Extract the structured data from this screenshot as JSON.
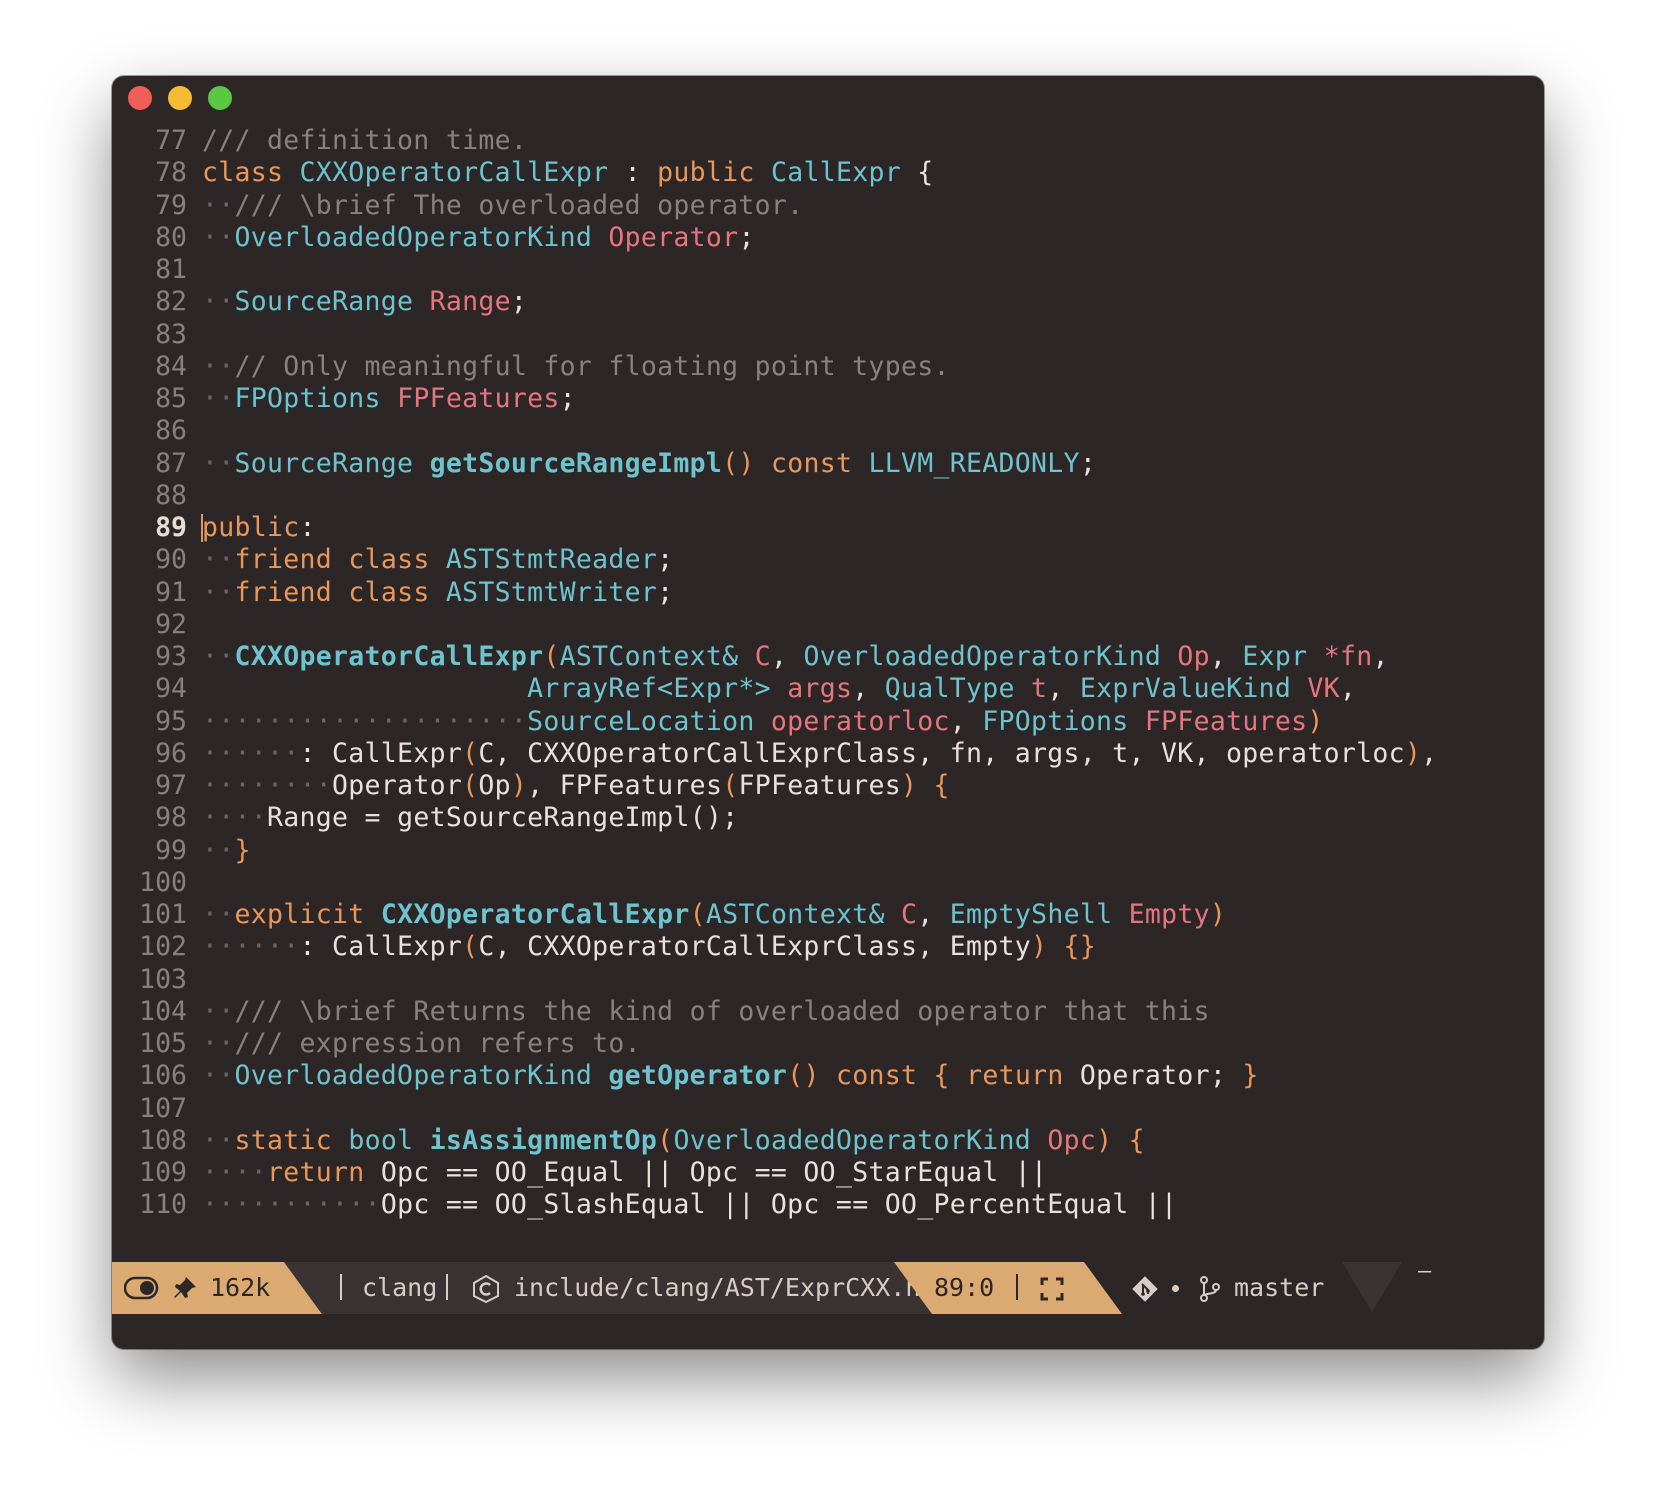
{
  "window": {
    "traffic_lights": [
      "close",
      "minimize",
      "maximize"
    ]
  },
  "editor": {
    "current_line": 89,
    "lines": [
      {
        "n": "77",
        "t": [
          [
            "cm",
            "/// definition time."
          ]
        ]
      },
      {
        "n": "78",
        "t": [
          [
            "kw",
            "class"
          ],
          [
            "pu",
            " "
          ],
          [
            "ty",
            "CXXOperatorCallExpr"
          ],
          [
            "pu",
            " : "
          ],
          [
            "kw",
            "public"
          ],
          [
            "pu",
            " "
          ],
          [
            "ty",
            "CallExpr"
          ],
          [
            "pu",
            " {"
          ]
        ]
      },
      {
        "n": "79",
        "t": [
          [
            "ws",
            "··"
          ],
          [
            "cm",
            "/// \\brief The overloaded operator."
          ]
        ]
      },
      {
        "n": "80",
        "t": [
          [
            "ws",
            "··"
          ],
          [
            "ty",
            "OverloadedOperatorKind"
          ],
          [
            "pu",
            " "
          ],
          [
            "va",
            "Operator"
          ],
          [
            "pu",
            ";"
          ]
        ]
      },
      {
        "n": "81",
        "t": []
      },
      {
        "n": "82",
        "t": [
          [
            "ws",
            "··"
          ],
          [
            "ty",
            "SourceRange"
          ],
          [
            "pu",
            " "
          ],
          [
            "va",
            "Range"
          ],
          [
            "pu",
            ";"
          ]
        ]
      },
      {
        "n": "83",
        "t": []
      },
      {
        "n": "84",
        "t": [
          [
            "ws",
            "··"
          ],
          [
            "cm",
            "// Only meaningful for floating point types."
          ]
        ]
      },
      {
        "n": "85",
        "t": [
          [
            "ws",
            "··"
          ],
          [
            "ty",
            "FPOptions"
          ],
          [
            "pu",
            " "
          ],
          [
            "va",
            "FPFeatures"
          ],
          [
            "pu",
            ";"
          ]
        ]
      },
      {
        "n": "86",
        "t": []
      },
      {
        "n": "87",
        "t": [
          [
            "ws",
            "··"
          ],
          [
            "ty",
            "SourceRange"
          ],
          [
            "pu",
            " "
          ],
          [
            "fn",
            "getSourceRangeImpl"
          ],
          [
            "pa",
            "()"
          ],
          [
            "pu",
            " "
          ],
          [
            "kw",
            "const"
          ],
          [
            "pu",
            " "
          ],
          [
            "ty",
            "LLVM_READONLY"
          ],
          [
            "pu",
            ";"
          ]
        ]
      },
      {
        "n": "88",
        "t": []
      },
      {
        "n": "89",
        "t": [
          [
            "kw",
            "public"
          ],
          [
            "pu",
            ":"
          ]
        ]
      },
      {
        "n": "90",
        "t": [
          [
            "ws",
            "··"
          ],
          [
            "kw",
            "friend"
          ],
          [
            "pu",
            " "
          ],
          [
            "kw",
            "class"
          ],
          [
            "pu",
            " "
          ],
          [
            "ty",
            "ASTStmtReader"
          ],
          [
            "pu",
            ";"
          ]
        ]
      },
      {
        "n": "91",
        "t": [
          [
            "ws",
            "··"
          ],
          [
            "kw",
            "friend"
          ],
          [
            "pu",
            " "
          ],
          [
            "kw",
            "class"
          ],
          [
            "pu",
            " "
          ],
          [
            "ty",
            "ASTStmtWriter"
          ],
          [
            "pu",
            ";"
          ]
        ]
      },
      {
        "n": "92",
        "t": []
      },
      {
        "n": "93",
        "t": [
          [
            "ws",
            "··"
          ],
          [
            "fn",
            "CXXOperatorCallExpr"
          ],
          [
            "pa",
            "("
          ],
          [
            "ty",
            "ASTContext&"
          ],
          [
            "pu",
            " "
          ],
          [
            "va",
            "C"
          ],
          [
            "pu",
            ", "
          ],
          [
            "ty",
            "OverloadedOperatorKind"
          ],
          [
            "pu",
            " "
          ],
          [
            "va",
            "Op"
          ],
          [
            "pu",
            ", "
          ],
          [
            "ty",
            "Expr"
          ],
          [
            "pu",
            " "
          ],
          [
            "va",
            "*fn"
          ],
          [
            "pu",
            ","
          ]
        ]
      },
      {
        "n": "94",
        "t": [
          [
            "pu",
            "                    "
          ],
          [
            "ty",
            "ArrayRef<Expr*>"
          ],
          [
            "pu",
            " "
          ],
          [
            "va",
            "args"
          ],
          [
            "pu",
            ", "
          ],
          [
            "ty",
            "QualType"
          ],
          [
            "pu",
            " "
          ],
          [
            "va",
            "t"
          ],
          [
            "pu",
            ", "
          ],
          [
            "ty",
            "ExprValueKind"
          ],
          [
            "pu",
            " "
          ],
          [
            "va",
            "VK"
          ],
          [
            "pu",
            ","
          ]
        ]
      },
      {
        "n": "95",
        "t": [
          [
            "ws",
            "····················"
          ],
          [
            "ty",
            "SourceLocation"
          ],
          [
            "pu",
            " "
          ],
          [
            "va",
            "operatorloc"
          ],
          [
            "pu",
            ", "
          ],
          [
            "ty",
            "FPOptions"
          ],
          [
            "pu",
            " "
          ],
          [
            "va",
            "FPFeatures"
          ],
          [
            "pa",
            ")"
          ]
        ]
      },
      {
        "n": "96",
        "t": [
          [
            "ws",
            "······"
          ],
          [
            "pu",
            ": CallExpr"
          ],
          [
            "pa",
            "("
          ],
          [
            "pu",
            "C, CXXOperatorCallExprClass, fn, args, t, VK, operatorloc"
          ],
          [
            "pa",
            ")"
          ],
          [
            "pu",
            ","
          ]
        ]
      },
      {
        "n": "97",
        "t": [
          [
            "ws",
            "········"
          ],
          [
            "pu",
            "Operator"
          ],
          [
            "pa",
            "("
          ],
          [
            "pu",
            "Op"
          ],
          [
            "pa",
            ")"
          ],
          [
            "pu",
            ", FPFeatures"
          ],
          [
            "pa",
            "("
          ],
          [
            "pu",
            "FPFeatures"
          ],
          [
            "pa",
            ")"
          ],
          [
            "pu",
            " "
          ],
          [
            "pa",
            "{"
          ]
        ]
      },
      {
        "n": "98",
        "t": [
          [
            "ws",
            "····"
          ],
          [
            "pu",
            "Range = getSourceRangeImpl();"
          ]
        ]
      },
      {
        "n": "99",
        "t": [
          [
            "ws",
            "··"
          ],
          [
            "pa",
            "}"
          ]
        ]
      },
      {
        "n": "100",
        "t": []
      },
      {
        "n": "101",
        "t": [
          [
            "ws",
            "··"
          ],
          [
            "kw",
            "explicit"
          ],
          [
            "pu",
            " "
          ],
          [
            "fn",
            "CXXOperatorCallExpr"
          ],
          [
            "pa",
            "("
          ],
          [
            "ty",
            "ASTContext&"
          ],
          [
            "pu",
            " "
          ],
          [
            "va",
            "C"
          ],
          [
            "pu",
            ", "
          ],
          [
            "ty",
            "EmptyShell"
          ],
          [
            "pu",
            " "
          ],
          [
            "va",
            "Empty"
          ],
          [
            "pa",
            ")"
          ]
        ]
      },
      {
        "n": "102",
        "t": [
          [
            "ws",
            "······"
          ],
          [
            "pu",
            ": CallExpr"
          ],
          [
            "pa",
            "("
          ],
          [
            "pu",
            "C, CXXOperatorCallExprClass, Empty"
          ],
          [
            "pa",
            ")"
          ],
          [
            "pu",
            " "
          ],
          [
            "pa",
            "{}"
          ]
        ]
      },
      {
        "n": "103",
        "t": []
      },
      {
        "n": "104",
        "t": [
          [
            "ws",
            "··"
          ],
          [
            "cm",
            "/// \\brief Returns the kind of overloaded operator that this"
          ]
        ]
      },
      {
        "n": "105",
        "t": [
          [
            "ws",
            "··"
          ],
          [
            "cm",
            "/// expression refers to."
          ]
        ]
      },
      {
        "n": "106",
        "t": [
          [
            "ws",
            "··"
          ],
          [
            "ty",
            "OverloadedOperatorKind"
          ],
          [
            "pu",
            " "
          ],
          [
            "fn",
            "getOperator"
          ],
          [
            "pa",
            "()"
          ],
          [
            "pu",
            " "
          ],
          [
            "kw",
            "const"
          ],
          [
            "pu",
            " "
          ],
          [
            "pa",
            "{"
          ],
          [
            "pu",
            " "
          ],
          [
            "kw",
            "return"
          ],
          [
            "pu",
            " Operator; "
          ],
          [
            "pa",
            "}"
          ]
        ]
      },
      {
        "n": "107",
        "t": []
      },
      {
        "n": "108",
        "t": [
          [
            "ws",
            "··"
          ],
          [
            "kw",
            "static"
          ],
          [
            "pu",
            " "
          ],
          [
            "ty",
            "bool"
          ],
          [
            "pu",
            " "
          ],
          [
            "fn",
            "isAssignmentOp"
          ],
          [
            "pa",
            "("
          ],
          [
            "ty",
            "OverloadedOperatorKind"
          ],
          [
            "pu",
            " "
          ],
          [
            "va",
            "Opc"
          ],
          [
            "pa",
            ")"
          ],
          [
            "pu",
            " "
          ],
          [
            "pa",
            "{"
          ]
        ]
      },
      {
        "n": "109",
        "t": [
          [
            "ws",
            "····"
          ],
          [
            "kw",
            "return"
          ],
          [
            "pu",
            " Opc == OO_Equal || Opc == OO_StarEqual ||"
          ]
        ]
      },
      {
        "n": "110",
        "t": [
          [
            "ws",
            "···········"
          ],
          [
            "pu",
            "Opc == OO_SlashEqual || Opc == OO_PercentEqual ||"
          ]
        ]
      }
    ]
  },
  "statusbar": {
    "buffer_size": "162k",
    "mode": "clang",
    "file_path": "include/clang/AST/ExprCXX.h",
    "position": "89:0",
    "branch": "master",
    "minimize_glyph": "—",
    "colors": {
      "accent": "#dbaa72",
      "accent_dark": "#2d2627",
      "mid": "#3b3233",
      "text_light": "#d8ccc6"
    }
  }
}
